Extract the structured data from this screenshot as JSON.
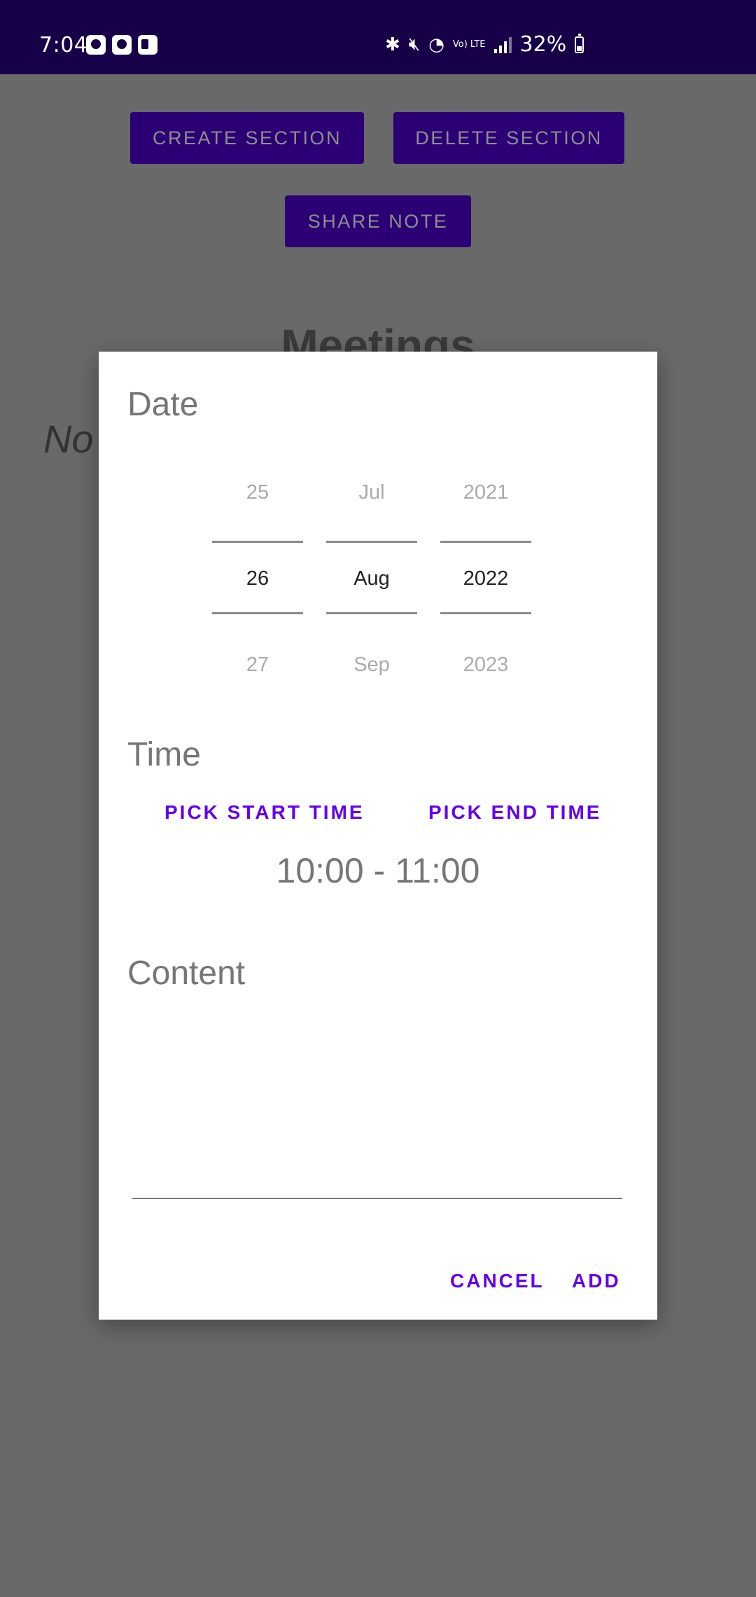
{
  "status_bar": {
    "time": "7:04",
    "battery": "32%",
    "lte_label": "Vo) LTE",
    "icons": [
      "notification-icon",
      "notification-icon",
      "outlook-icon",
      "bluetooth-icon",
      "mute-icon",
      "wifi-icon",
      "volte-icon",
      "signal-icon",
      "battery-icon"
    ]
  },
  "background": {
    "create_section": "CREATE SECTION",
    "delete_section": "DELETE SECTION",
    "share_note": "SHARE NOTE",
    "title": "Meetings",
    "italic_text": "No"
  },
  "dialog": {
    "date_label": "Date",
    "day": {
      "prev": "25",
      "selected": "26",
      "next": "27"
    },
    "month": {
      "prev": "Jul",
      "selected": "Aug",
      "next": "Sep"
    },
    "year": {
      "prev": "2021",
      "selected": "2022",
      "next": "2023"
    },
    "time_label": "Time",
    "pick_start": "PICK START TIME",
    "pick_end": "PICK END TIME",
    "time_range": "10:00 - 11:00",
    "content_label": "Content",
    "content_value": "",
    "cancel": "CANCEL",
    "add": "ADD"
  },
  "colors": {
    "accent": "#6200ee",
    "status_bar": "#170048",
    "scrim": "#696969",
    "button_bg": "#2c0075"
  }
}
